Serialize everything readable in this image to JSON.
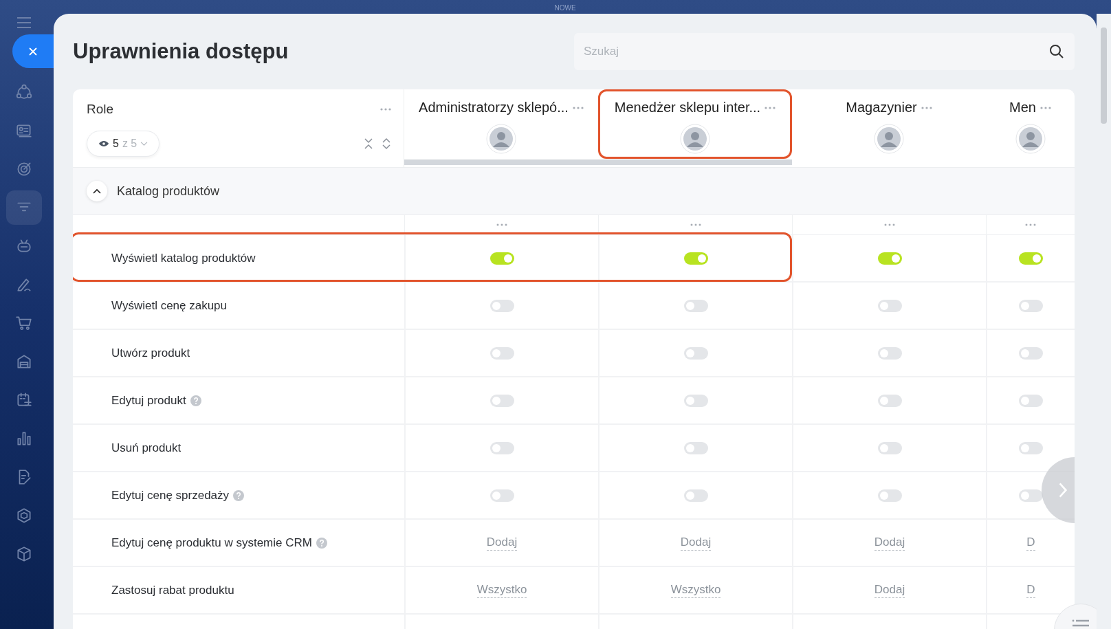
{
  "top_label": "NOWE",
  "sidebar": {
    "items": [
      {
        "kind": "flow",
        "selected": false
      },
      {
        "kind": "card",
        "selected": false
      },
      {
        "kind": "target",
        "selected": false
      },
      {
        "kind": "funnel",
        "selected": true
      },
      {
        "kind": "robot",
        "selected": false
      },
      {
        "kind": "pen",
        "selected": false
      },
      {
        "kind": "cart",
        "selected": false
      },
      {
        "kind": "store",
        "selected": false
      },
      {
        "kind": "calendar",
        "selected": false
      },
      {
        "kind": "chart",
        "selected": false
      },
      {
        "kind": "doc",
        "selected": false
      },
      {
        "kind": "hexagon",
        "selected": false
      },
      {
        "kind": "box",
        "selected": false
      }
    ]
  },
  "title": "Uprawnienia dostępu",
  "search": {
    "placeholder": "Szukaj"
  },
  "roles_header": {
    "label": "Role",
    "count": "5",
    "total": "z 5"
  },
  "columns": [
    {
      "title": "Administratorzy sklepó...",
      "highlighted": false
    },
    {
      "title": "Menedżer sklepu inter...",
      "highlighted": true
    },
    {
      "title": "Magazynier",
      "highlighted": false
    },
    {
      "title": "Men",
      "highlighted": false
    }
  ],
  "section": {
    "title": "Katalog produktów",
    "expanded": true
  },
  "rows": [
    {
      "name": "Wyświetl katalog produktów",
      "help": false,
      "highlighted": true,
      "cells": [
        {
          "kind": "toggle",
          "on": true
        },
        {
          "kind": "toggle",
          "on": true
        },
        {
          "kind": "toggle",
          "on": true
        },
        {
          "kind": "toggle",
          "on": true
        }
      ]
    },
    {
      "name": "Wyświetl cenę zakupu",
      "help": false,
      "highlighted": false,
      "cells": [
        {
          "kind": "toggle",
          "on": false
        },
        {
          "kind": "toggle",
          "on": false
        },
        {
          "kind": "toggle",
          "on": false
        },
        {
          "kind": "toggle",
          "on": false
        }
      ]
    },
    {
      "name": "Utwórz produkt",
      "help": false,
      "highlighted": false,
      "cells": [
        {
          "kind": "toggle",
          "on": false
        },
        {
          "kind": "toggle",
          "on": false
        },
        {
          "kind": "toggle",
          "on": false
        },
        {
          "kind": "toggle",
          "on": false
        }
      ]
    },
    {
      "name": "Edytuj produkt",
      "help": true,
      "highlighted": false,
      "cells": [
        {
          "kind": "toggle",
          "on": false
        },
        {
          "kind": "toggle",
          "on": false
        },
        {
          "kind": "toggle",
          "on": false
        },
        {
          "kind": "toggle",
          "on": false
        }
      ]
    },
    {
      "name": "Usuń produkt",
      "help": false,
      "highlighted": false,
      "cells": [
        {
          "kind": "toggle",
          "on": false
        },
        {
          "kind": "toggle",
          "on": false
        },
        {
          "kind": "toggle",
          "on": false
        },
        {
          "kind": "toggle",
          "on": false
        }
      ]
    },
    {
      "name": "Edytuj cenę sprzedaży",
      "help": true,
      "highlighted": false,
      "cells": [
        {
          "kind": "toggle",
          "on": false
        },
        {
          "kind": "toggle",
          "on": false
        },
        {
          "kind": "toggle",
          "on": false
        },
        {
          "kind": "toggle",
          "on": false
        }
      ]
    },
    {
      "name": "Edytuj cenę produktu w systemie CRM",
      "help": true,
      "highlighted": false,
      "cells": [
        {
          "kind": "link",
          "text": "Dodaj"
        },
        {
          "kind": "link",
          "text": "Dodaj"
        },
        {
          "kind": "link",
          "text": "Dodaj"
        },
        {
          "kind": "link",
          "text": "D"
        }
      ]
    },
    {
      "name": "Zastosuj rabat produktu",
      "help": false,
      "highlighted": false,
      "cells": [
        {
          "kind": "link",
          "text": "Wszystko"
        },
        {
          "kind": "link",
          "text": "Wszystko"
        },
        {
          "kind": "link",
          "text": "Dodaj"
        },
        {
          "kind": "link",
          "text": "D"
        }
      ]
    }
  ]
}
